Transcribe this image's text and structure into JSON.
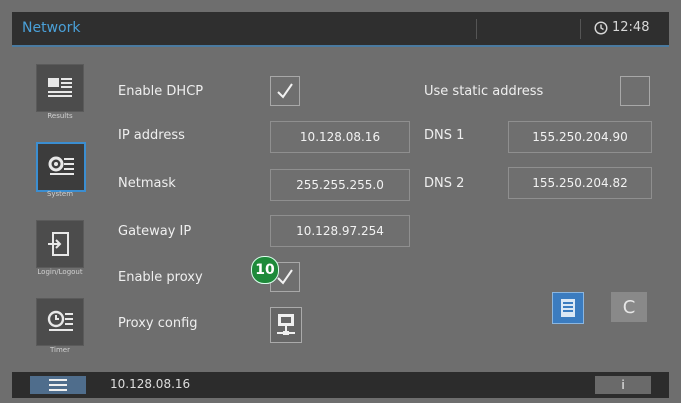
{
  "header": {
    "title": "Network",
    "time": "12:48"
  },
  "sidebar": {
    "items": [
      {
        "label": "Results"
      },
      {
        "label": "System"
      },
      {
        "label": "Login/Logout"
      },
      {
        "label": "Timer"
      }
    ]
  },
  "form": {
    "enable_dhcp_label": "Enable DHCP",
    "enable_dhcp_checked": true,
    "use_static_label": "Use static address",
    "use_static_checked": false,
    "ip_label": "IP address",
    "ip_value": "10.128.08.16",
    "netmask_label": "Netmask",
    "netmask_value": "255.255.255.0",
    "gateway_label": "Gateway IP",
    "gateway_value": "10.128.97.254",
    "dns1_label": "DNS 1",
    "dns1_value": "155.250.204.90",
    "dns2_label": "DNS 2",
    "dns2_value": "155.250.204.82",
    "enable_proxy_label": "Enable proxy",
    "enable_proxy_checked": true,
    "proxy_config_label": "Proxy config"
  },
  "annotation": {
    "marker": "10"
  },
  "buttons": {
    "cancel_label": "C"
  },
  "status": {
    "ip": "10.128.08.16",
    "info_label": "i"
  },
  "colors": {
    "accent": "#3b8ed1",
    "title": "#4aa0d8",
    "marker": "#1e8a3a"
  }
}
